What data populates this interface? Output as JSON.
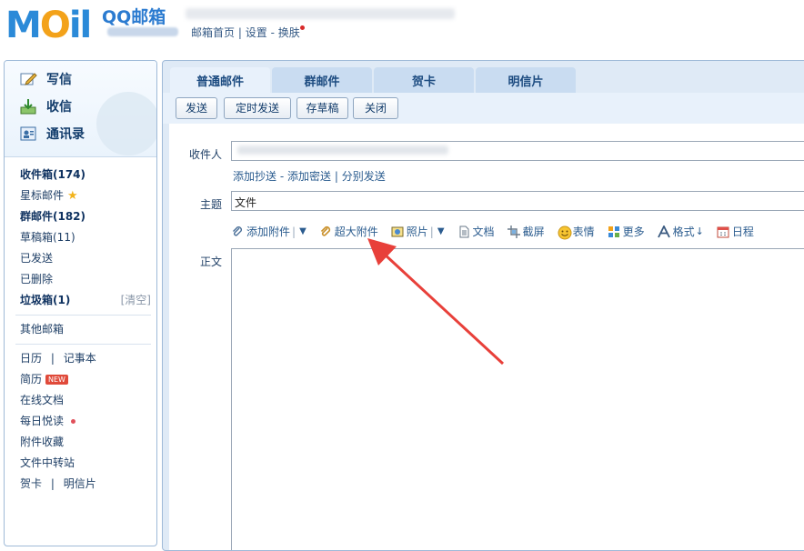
{
  "header": {
    "logo_text": "MOil",
    "brand": "QQ邮箱",
    "links": [
      "邮箱首页",
      "设置",
      "换肤"
    ],
    "link_seps": [
      "|",
      "-"
    ]
  },
  "quick_actions": [
    {
      "label": "写信",
      "icon": "pencil-icon"
    },
    {
      "label": "收信",
      "icon": "inbox-download-icon"
    },
    {
      "label": "通讯录",
      "icon": "contacts-icon"
    }
  ],
  "folders": {
    "inbox": "收件箱(174)",
    "starred": "星标邮件",
    "group": "群邮件(182)",
    "drafts": "草稿箱(11)",
    "sent": "已发送",
    "deleted": "已删除",
    "spam": "垃圾箱(1)",
    "spam_clear": "[清空]",
    "other": "其他邮箱",
    "calendar": "日历",
    "notes": "记事本",
    "resume": "简历",
    "resume_badge": "NEW",
    "docs": "在线文档",
    "daily": "每日悦读",
    "attach_fav": "附件收藏",
    "transfer": "文件中转站",
    "card": "贺卡",
    "postcard": "明信片",
    "sep": "|"
  },
  "tabs": [
    "普通邮件",
    "群邮件",
    "贺卡",
    "明信片"
  ],
  "toolbar": [
    "发送",
    "定时发送",
    "存草稿",
    "关闭"
  ],
  "compose": {
    "to_label": "收件人",
    "cc_links": [
      "添加抄送",
      "添加密送",
      "分别发送"
    ],
    "cc_seps": [
      "-",
      "|"
    ],
    "subject_label": "主题",
    "subject_value": "文件",
    "body_label": "正文"
  },
  "attach_tools": [
    {
      "label": "添加附件",
      "icon": "paperclip-icon",
      "dropdown": true
    },
    {
      "label": "超大附件",
      "icon": "large-attachment-icon",
      "dropdown": false
    },
    {
      "label": "照片",
      "icon": "photo-icon",
      "dropdown": true
    },
    {
      "label": "文档",
      "icon": "document-icon",
      "dropdown": false
    },
    {
      "label": "截屏",
      "icon": "screenshot-icon",
      "dropdown": false
    },
    {
      "label": "表情",
      "icon": "emoji-icon",
      "dropdown": false
    },
    {
      "label": "更多",
      "icon": "more-grid-icon",
      "dropdown": false
    },
    {
      "label": "格式",
      "icon": "format-icon",
      "dropdown": false
    },
    {
      "label": "日程",
      "icon": "calendar-icon",
      "dropdown": false
    }
  ],
  "colors": {
    "brand_blue": "#2b8ad8",
    "brand_orange": "#f3a21a",
    "annotation_arrow": "#e8403a"
  }
}
